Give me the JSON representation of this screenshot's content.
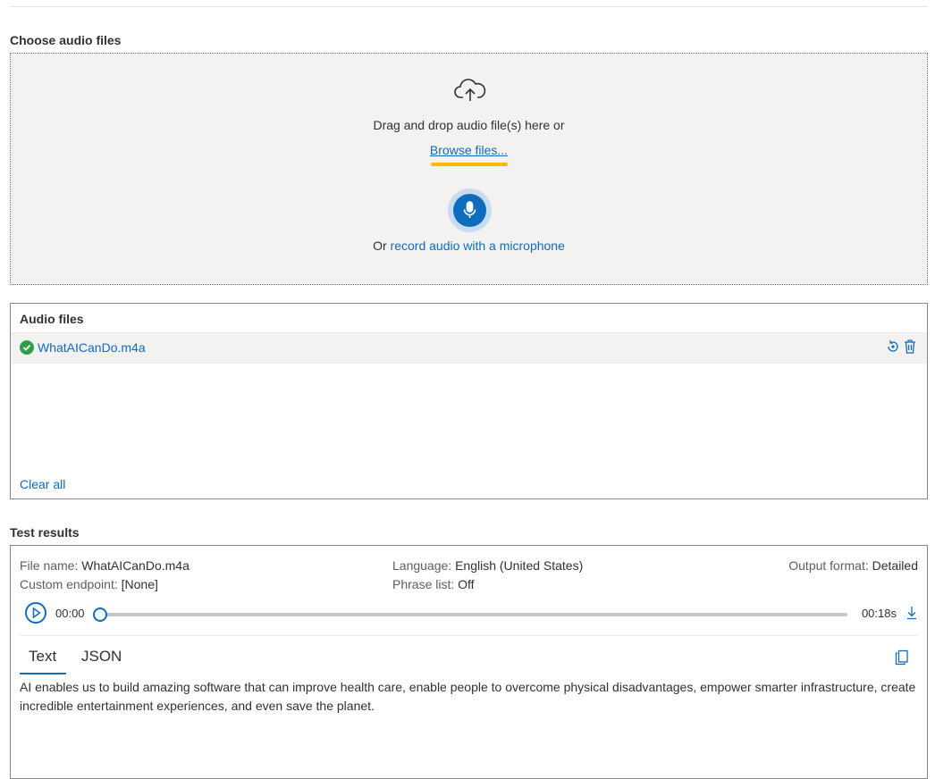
{
  "choose": {
    "title": "Choose audio files",
    "drag_text": "Drag and drop audio file(s) here or",
    "browse_label": "Browse files...",
    "record_prefix": "Or",
    "record_link": "record audio with a microphone",
    "highlight_color": "#ffb900"
  },
  "audio_files": {
    "title": "Audio files",
    "items": [
      {
        "name": "WhatAICanDo.m4a",
        "status": "success"
      }
    ],
    "clear_all": "Clear all"
  },
  "results": {
    "title": "Test results",
    "file_name_label": "File name:",
    "file_name": "WhatAICanDo.m4a",
    "custom_endpoint_label": "Custom endpoint:",
    "custom_endpoint": "[None]",
    "language_label": "Language:",
    "language": "English (United States)",
    "phrase_list_label": "Phrase list:",
    "phrase_list": "Off",
    "output_format_label": "Output format:",
    "output_format": "Detailed",
    "player": {
      "current_time": "00:00",
      "duration": "00:18s",
      "progress": 0
    },
    "tabs": [
      {
        "label": "Text",
        "active": true
      },
      {
        "label": "JSON",
        "active": false
      }
    ],
    "transcript": "AI enables us to build amazing software that can improve health care, enable people to overcome physical disadvantages, empower smarter infrastructure, create incredible entertainment experiences, and even save the planet."
  },
  "colors": {
    "accent": "#0f6cbd",
    "success": "#2ea043"
  }
}
